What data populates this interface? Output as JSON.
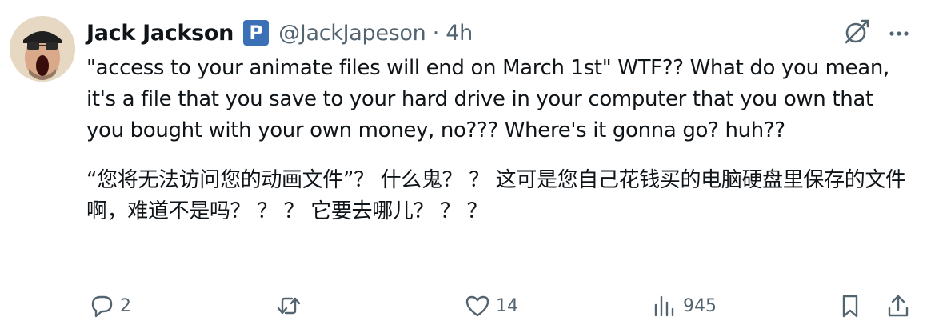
{
  "author": {
    "display_name": "Jack Jackson",
    "badge_letter": "P",
    "handle_time": "@JackJapeson · 4h"
  },
  "tweet": {
    "text_en": "\"access to your animate files will end on March 1st\" WTF?? What do you mean, it's a file that you save to your hard drive in your computer that you own that you bought with your own money, no??? Where's it gonna go? huh??",
    "text_zh": "“您将无法访问您的动画文件”？ 什么鬼？ ？ 这可是您自己花钱买的电脑硬盘里保存的文件啊，难道不是吗？ ？ ？ 它要去哪儿？ ？ ？"
  },
  "actions": {
    "reply_count": "2",
    "retweet_count": "",
    "like_count": "14",
    "views_count": "945"
  },
  "icons": {
    "avatar": "avatar-photo",
    "badge": "badge-icon",
    "grok": "grok-icon",
    "more": "more-icon",
    "reply": "reply-icon",
    "retweet": "retweet-icon",
    "like": "like-icon",
    "views": "views-icon",
    "bookmark": "bookmark-icon",
    "share": "share-icon"
  },
  "colors": {
    "text": "#0f1419",
    "secondary": "#536471",
    "badge": "#3b6fb6"
  }
}
